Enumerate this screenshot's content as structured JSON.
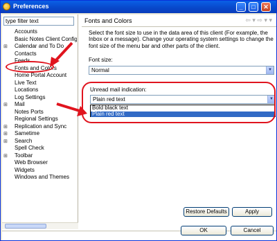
{
  "window": {
    "title": "Preferences"
  },
  "title_buttons": {
    "minimize": "_",
    "maximize": "□",
    "close": "✕"
  },
  "filter": {
    "value": "type filter text"
  },
  "tree": [
    {
      "label": "Accounts",
      "expandable": false
    },
    {
      "label": "Basic Notes Client Configur",
      "expandable": false
    },
    {
      "label": "Calendar and To Do",
      "expandable": true
    },
    {
      "label": "Contacts",
      "expandable": false
    },
    {
      "label": "Feeds",
      "expandable": false
    },
    {
      "label": "Fonts and Colors",
      "expandable": false,
      "selected": true
    },
    {
      "label": "Home Portal Account",
      "expandable": false
    },
    {
      "label": "Live Text",
      "expandable": false
    },
    {
      "label": "Locations",
      "expandable": false
    },
    {
      "label": "Log Settings",
      "expandable": false
    },
    {
      "label": "Mail",
      "expandable": true
    },
    {
      "label": "Notes Ports",
      "expandable": false
    },
    {
      "label": "Regional Settings",
      "expandable": false
    },
    {
      "label": "Replication and Sync",
      "expandable": true
    },
    {
      "label": "Sametime",
      "expandable": true
    },
    {
      "label": "Search",
      "expandable": true
    },
    {
      "label": "Spell Check",
      "expandable": false
    },
    {
      "label": "Toolbar",
      "expandable": true
    },
    {
      "label": "Web Browser",
      "expandable": false
    },
    {
      "label": "Widgets",
      "expandable": false
    },
    {
      "label": "Windows and Themes",
      "expandable": false
    }
  ],
  "page": {
    "title": "Fonts and Colors",
    "nav": "⇦ ▾ ⇨ ▾ ▾",
    "description": "Select the font size to use in the data area of this client (For example, the Inbox or a message). Change your operating system settings to change the font size of the menu bar and other parts of the client.",
    "font_size_label": "Font size:",
    "font_size_value": "Normal",
    "unread_label": "Unread mail indication:",
    "unread_value": "Plain red text",
    "unread_options": [
      {
        "label": "Bold black text",
        "selected": false
      },
      {
        "label": "Plain red text",
        "selected": true
      }
    ]
  },
  "buttons": {
    "restore_defaults": "Restore Defaults",
    "apply": "Apply",
    "ok": "OK",
    "cancel": "Cancel"
  },
  "colors": {
    "annotation": "#e0141e",
    "selection": "#316ac5",
    "title_bar": "#0a5fe6"
  }
}
